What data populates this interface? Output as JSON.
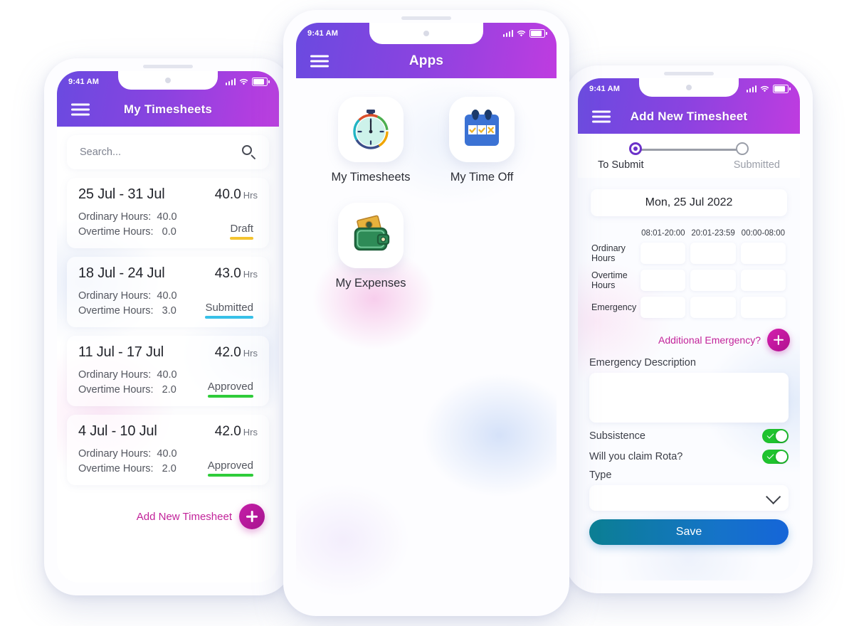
{
  "status_bar": {
    "time": "9:41 AM"
  },
  "left_phone": {
    "header_title": "My Timesheets",
    "search": {
      "placeholder": "Search..."
    },
    "timesheets": [
      {
        "range": "25 Jul - 31 Jul",
        "hours": "40.0",
        "hours_unit": "Hrs",
        "ordinary": "Ordinary Hours:  40.0",
        "overtime": "Overtime Hours:   0.0",
        "status": "Draft",
        "status_color": "#f4c430"
      },
      {
        "range": "18 Jul - 24 Jul",
        "hours": "43.0",
        "hours_unit": "Hrs",
        "ordinary": "Ordinary Hours:  40.0",
        "overtime": "Overtime Hours:   3.0",
        "status": "Submitted",
        "status_color": "#38c0e8"
      },
      {
        "range": "11 Jul - 17 Jul",
        "hours": "42.0",
        "hours_unit": "Hrs",
        "ordinary": "Ordinary Hours:  40.0",
        "overtime": "Overtime Hours:   2.0",
        "status": "Approved",
        "status_color": "#2fcc3a"
      },
      {
        "range": "4 Jul - 10 Jul",
        "hours": "42.0",
        "hours_unit": "Hrs",
        "ordinary": "Ordinary Hours:  40.0",
        "overtime": "Overtime Hours:   2.0",
        "status": "Approved",
        "status_color": "#2fcc3a"
      }
    ],
    "add_new_label": "Add New Timesheet"
  },
  "mid_phone": {
    "header_title": "Apps",
    "apps": [
      {
        "label": "My Timesheets",
        "icon": "stopwatch-icon"
      },
      {
        "label": "My Time Off",
        "icon": "calendar-icon"
      },
      {
        "label": "My Expenses",
        "icon": "wallet-icon"
      }
    ]
  },
  "right_phone": {
    "header_title": "Add New Timesheet",
    "steps": [
      {
        "label": "To Submit",
        "state": "active"
      },
      {
        "label": "Submitted",
        "state": "idle"
      }
    ],
    "date_value": "Mon, 25 Jul 2022",
    "grid": {
      "columns": [
        "08:01-20:00",
        "20:01-23:59",
        "00:00-08:00"
      ],
      "rows": [
        {
          "label": "Ordinary\nHours",
          "values": [
            "",
            "",
            ""
          ]
        },
        {
          "label": "Overtime\nHours",
          "values": [
            "",
            "",
            ""
          ]
        },
        {
          "label": "Emergency",
          "values": [
            "",
            "",
            ""
          ]
        }
      ]
    },
    "additional_emergency_label": "Additional Emergency?",
    "emergency_description_label": "Emergency Description",
    "emergency_description_value": "",
    "subsistence_label": "Subsistence",
    "subsistence_on": true,
    "rota_label": "Will you claim Rota?",
    "rota_on": true,
    "type_label": "Type",
    "type_value": "",
    "save_label": "Save"
  },
  "theme": {
    "header_gradient_from": "#6a4ae0",
    "header_gradient_to": "#bf3ce0",
    "accent_pink": "#c2239a",
    "save_gradient_from": "#0b7f93",
    "save_gradient_to": "#1565d8",
    "toggle_green": "#1fc32e"
  }
}
